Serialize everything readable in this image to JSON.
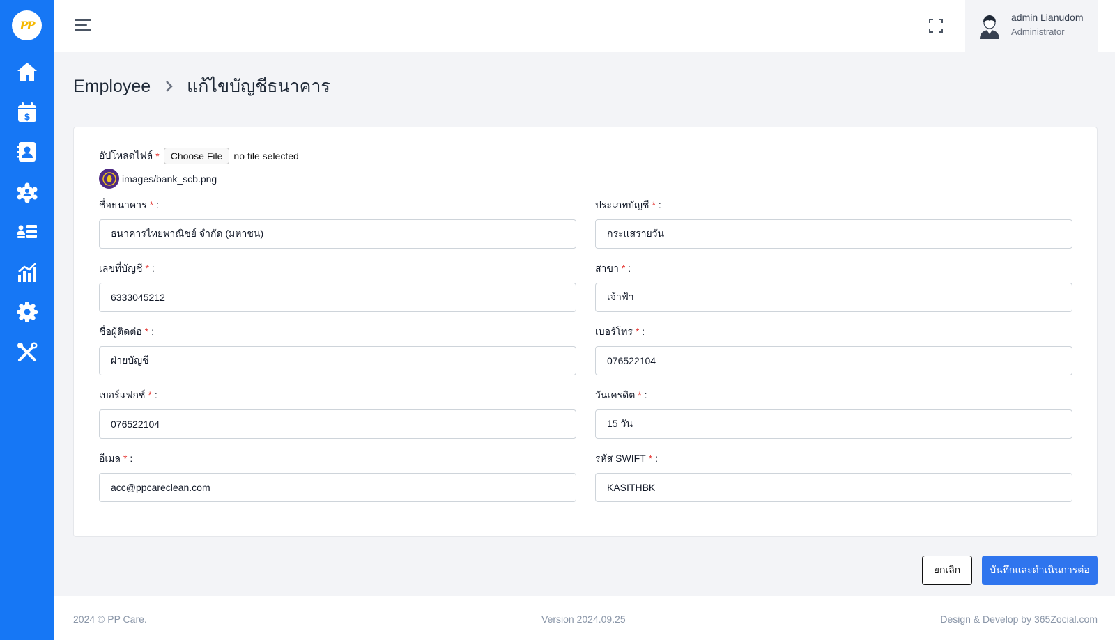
{
  "app": {
    "logo_text": "PP"
  },
  "sidebar": {
    "items": [
      {
        "name": "home",
        "icon": "home-icon"
      },
      {
        "name": "payroll-calendar",
        "icon": "calendar-dollar-icon"
      },
      {
        "name": "contacts",
        "icon": "address-book-icon"
      },
      {
        "name": "teams",
        "icon": "users-gear-icon"
      },
      {
        "name": "list",
        "icon": "user-list-icon"
      },
      {
        "name": "reports",
        "icon": "chart-bars-icon"
      },
      {
        "name": "settings",
        "icon": "gear-icon"
      },
      {
        "name": "tools",
        "icon": "tools-icon"
      }
    ]
  },
  "header": {
    "user_name": "admin Lianudom",
    "user_role": "Administrator"
  },
  "breadcrumb": {
    "parent": "Employee",
    "current": "แก้ไขบัญชีธนาคาร"
  },
  "form": {
    "upload_label": "อัปโหลดไฟล์",
    "choose_file": "Choose File",
    "no_file": "no file selected",
    "current_file": "images/bank_scb.png",
    "fields": {
      "bank_name": {
        "label": "ชื่อธนาคาร",
        "value": "ธนาคารไทยพาณิชย์ จำกัด (มหาชน)"
      },
      "account_type": {
        "label": "ประเภทบัญชี",
        "value": "กระแสรายวัน"
      },
      "account_no": {
        "label": "เลขที่บัญชี",
        "value": "6333045212"
      },
      "branch": {
        "label": "สาขา",
        "value": "เจ้าฟ้า"
      },
      "contact_name": {
        "label": "ชื่อผู้ติดต่อ",
        "value": "ฝ่ายบัญชี"
      },
      "phone": {
        "label": "เบอร์โทร",
        "value": "076522104"
      },
      "fax": {
        "label": "เบอร์แฟกซ์",
        "value": "076522104"
      },
      "credit_days": {
        "label": "วันเครดิต",
        "value": "15 วัน"
      },
      "email": {
        "label": "อีเมล",
        "value": "acc@ppcareclean.com"
      },
      "swift": {
        "label": "รหัส SWIFT",
        "value": "KASITHBK"
      }
    },
    "required_mark": "*",
    "label_suffix": ":"
  },
  "actions": {
    "cancel": "ยกเลิก",
    "save": "บันทึกและดำเนินการต่อ"
  },
  "footer": {
    "copyright": "2024 © PP Care.",
    "version": "Version 2024.09.25",
    "credit": "Design & Develop by 365Zocial.com"
  },
  "colors": {
    "sidebar": "#1677f5",
    "primary_button": "#2f75ee",
    "required": "#e53935"
  }
}
